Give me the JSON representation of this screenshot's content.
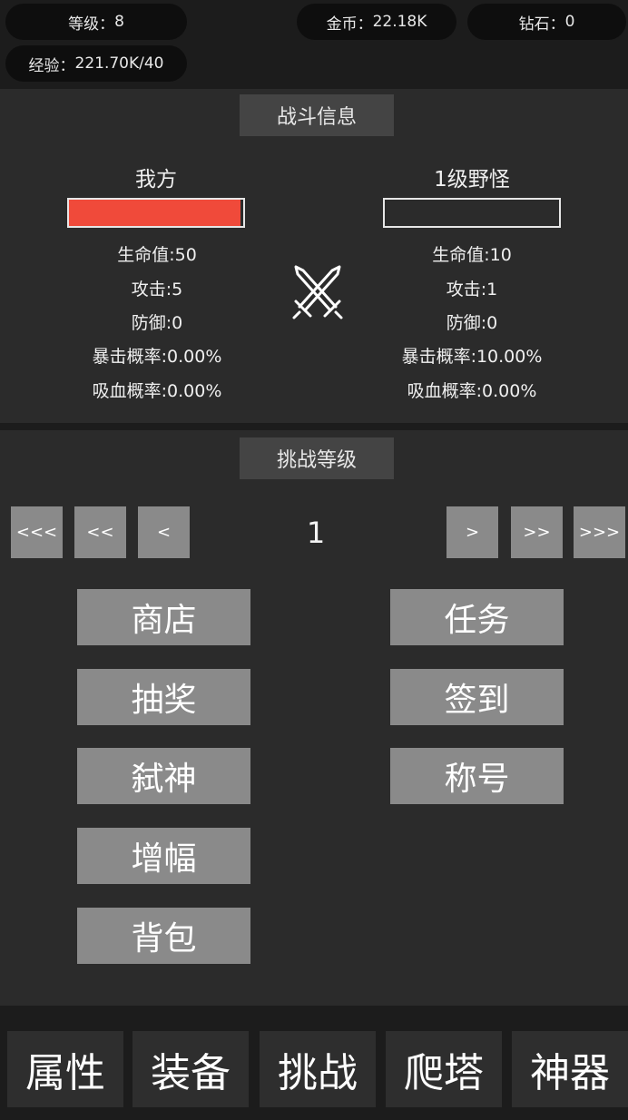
{
  "header": {
    "level": {
      "label": "等级",
      "colon": "：",
      "value": "8"
    },
    "gold": {
      "label": "金币",
      "colon": "：",
      "value": "22.18K"
    },
    "diamond": {
      "label": "钻石",
      "colon": "：",
      "value": "0"
    },
    "exp": {
      "label": "经验",
      "colon": "：",
      "value": "221.70K/40"
    }
  },
  "battle": {
    "title": "战斗信息",
    "player": {
      "name": "我方",
      "hp_fraction": 1.0,
      "stats": [
        "生命值:50",
        "攻击:5",
        "防御:0",
        "暴击概率:0.00%",
        "吸血概率:0.00%"
      ]
    },
    "enemy": {
      "name": "1级野怪",
      "hp_fraction": 0.0,
      "stats": [
        "生命值:10",
        "攻击:1",
        "防御:0",
        "暴击概率:10.00%",
        "吸血概率:0.00%"
      ]
    },
    "vs_icon": "crossed-swords-icon"
  },
  "challenge": {
    "title": "挑战等级",
    "nav": [
      "<<<",
      "<<",
      "<",
      ">",
      ">>",
      ">>>"
    ],
    "level": "1"
  },
  "menu": {
    "shop": "商店",
    "task": "任务",
    "lottery": "抽奖",
    "checkin": "签到",
    "slay_god": "弑神",
    "title": "称号",
    "amplify": "增幅",
    "bag": "背包"
  },
  "tabs": [
    "属性",
    "装备",
    "挑战",
    "爬塔",
    "神器"
  ],
  "colors": {
    "hp_fill": "#f04a3a",
    "button": "#8a8a8a",
    "panel": "#2b2b2b",
    "background": "#1c1c1c"
  }
}
